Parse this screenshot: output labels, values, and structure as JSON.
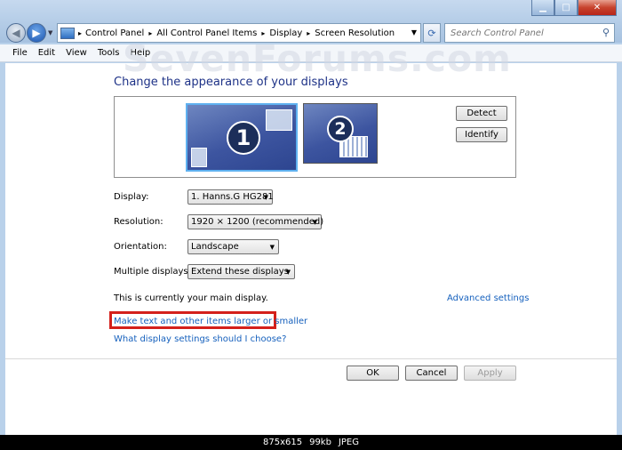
{
  "address": {
    "crumbs": [
      "Control Panel",
      "All Control Panel Items",
      "Display",
      "Screen Resolution"
    ],
    "separator": "▸"
  },
  "search": {
    "placeholder": "Search Control Panel"
  },
  "menu": [
    "File",
    "Edit",
    "View",
    "Tools",
    "Help"
  ],
  "watermark": "SevenForums.com",
  "heading": "Change the appearance of your displays",
  "monitors": {
    "one": "1",
    "two": "2"
  },
  "buttons": {
    "detect": "Detect",
    "identify": "Identify",
    "ok": "OK",
    "cancel": "Cancel",
    "apply": "Apply"
  },
  "fields": {
    "display": {
      "label": "Display:",
      "value": "1. Hanns.G HG281"
    },
    "resolution": {
      "label": "Resolution:",
      "value": "1920 × 1200 (recommended)"
    },
    "orientation": {
      "label": "Orientation:",
      "value": "Landscape"
    },
    "multiple": {
      "label": "Multiple displays:",
      "value": "Extend these displays"
    }
  },
  "main_display_text": "This is currently your main display.",
  "links": {
    "advanced": "Advanced settings",
    "larger": "Make text and other items larger or smaller",
    "choose": "What display settings should I choose?"
  },
  "status": {
    "dimensions": "875x615",
    "size": "99kb",
    "format": "JPEG"
  },
  "colors": {
    "heading": "#1e3287",
    "link": "#1560bd",
    "highlight": "#d4201b"
  }
}
